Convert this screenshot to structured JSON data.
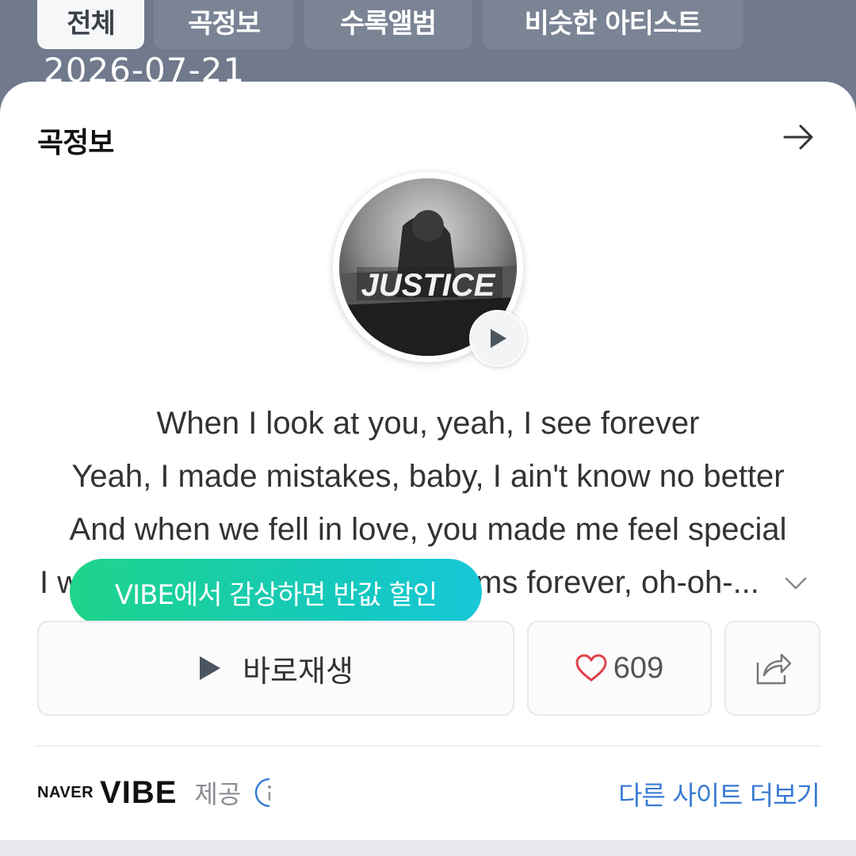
{
  "tabs": [
    {
      "label": "전체",
      "active": true
    },
    {
      "label": "곡정보",
      "active": false
    },
    {
      "label": "수록앨범",
      "active": false
    },
    {
      "label": "비슷한 아티스트",
      "active": false
    }
  ],
  "overlay_date": "2026-07-21",
  "card": {
    "title": "곡정보",
    "album_text": "JUSTICE"
  },
  "lyrics": [
    "When I look at you, yeah, I see forever",
    "Yeah, I made mistakes, baby, I ain't know no better",
    "And when we fell in love, you made me feel special",
    "I w... ms forever, oh-oh-..."
  ],
  "lyrics_partial": {
    "start": "I w",
    "end": "ms forever, oh-oh-..."
  },
  "tooltip": "VIBE에서 감상하면 반값 할인",
  "actions": {
    "play_label": "바로재생",
    "like_count": "609"
  },
  "footer": {
    "naver": "NAVER",
    "vibe": "VIBE",
    "provide": "제공",
    "more_link": "다른 사이트 더보기"
  },
  "colors": {
    "background": "#707a8c",
    "accent_green": "#1fd48a",
    "link_blue": "#3a7bd5",
    "heart_red": "#e0414a"
  },
  "icons": [
    "arrow-right-icon",
    "play-icon",
    "chevron-down-icon",
    "heart-icon",
    "share-icon",
    "info-icon"
  ]
}
